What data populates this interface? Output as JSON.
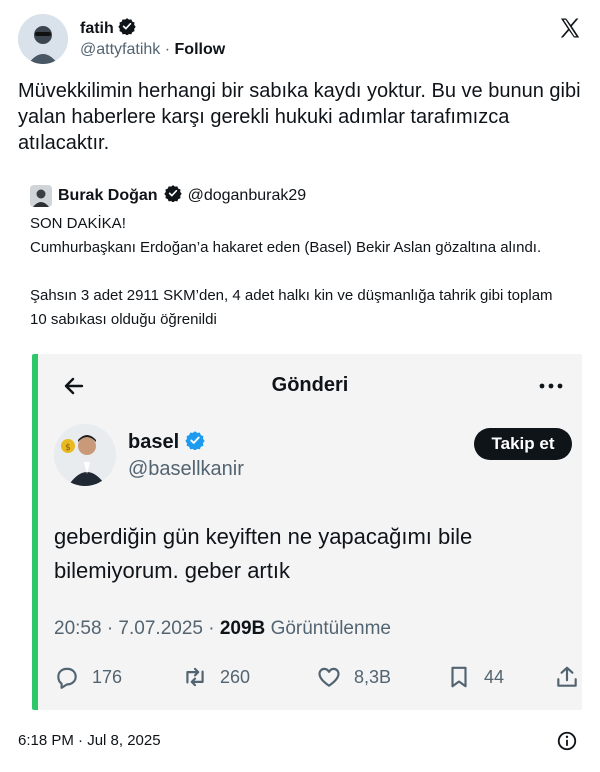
{
  "post": {
    "author_name": "fatih",
    "author_handle": "@attyfatihk",
    "separator": "·",
    "follow_label": "Follow",
    "text": "Müvekkilimin herhangi bir sabıka kaydı yoktur. Bu ve bunun gibi yalan haberlere karşı gerekli hukuki adımlar tarafımızca atılacaktır.",
    "timestamp": "6:18 PM · Jul 8, 2025",
    "icons": {
      "platform": "x-logo-icon",
      "verified": "verified-badge-icon",
      "info": "info-icon"
    }
  },
  "quote": {
    "author_name": "Burak Doğan",
    "author_handle": "@doganburak29",
    "line1": "SON DAKİKA!",
    "line2": "Cumhurbaşkanı Erdoğan’a hakaret eden (Basel) Bekir Aslan gözaltına alındı.",
    "line3": "Şahsın 3 adet 2911 SKM’den, 4 adet halkı kin ve düşmanlığa tahrik gibi toplam 10 sabıkası olduğu öğrenildi"
  },
  "embed": {
    "title": "Gönderi",
    "author_name": "basel",
    "author_handle": "@basellkanir",
    "follow_label": "Takip et",
    "text": "geberdiğin gün keyiften ne yapacağımı bile bilemiyorum. geber artık",
    "time": "20:58 · 7.07.2025 ·",
    "views_count": "209B",
    "views_label": "Görüntülenme",
    "replies": "176",
    "reposts": "260",
    "likes": "8,3B",
    "bookmarks": "44",
    "accent_color": "#2fc66a"
  }
}
